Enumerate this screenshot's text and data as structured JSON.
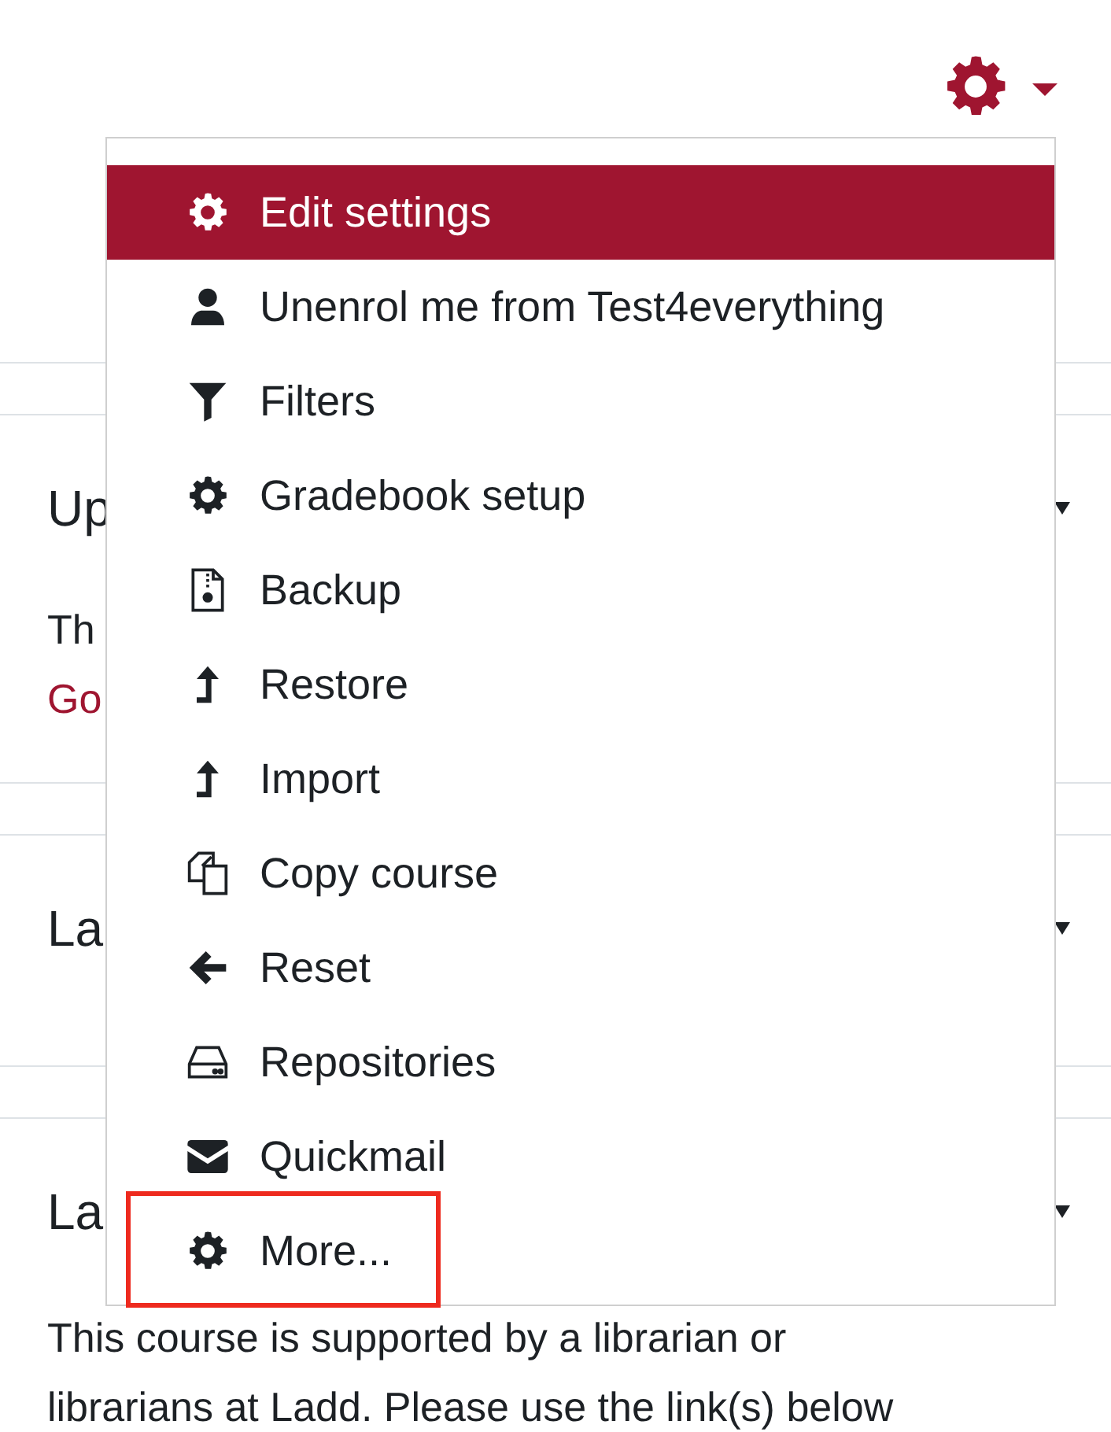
{
  "sections": [
    {
      "title": "Up",
      "lines": [
        {
          "text": "Th",
          "kind": "text"
        },
        {
          "text": "Go",
          "kind": "link"
        }
      ]
    },
    {
      "title": "La"
    },
    {
      "title": "La",
      "lines": [
        {
          "text": "This course is supported by a librarian or",
          "kind": "text"
        },
        {
          "text": "librarians at Ladd. Please use the link(s) below",
          "kind": "text"
        }
      ]
    }
  ],
  "menu": {
    "items": [
      {
        "label": "Edit settings",
        "selected": true,
        "annotated": false
      },
      {
        "label": "Unenrol me from Test4everything",
        "selected": false,
        "annotated": false
      },
      {
        "label": "Filters",
        "selected": false,
        "annotated": false
      },
      {
        "label": "Gradebook setup",
        "selected": false,
        "annotated": false
      },
      {
        "label": "Backup",
        "selected": false,
        "annotated": false
      },
      {
        "label": "Restore",
        "selected": false,
        "annotated": false
      },
      {
        "label": "Import",
        "selected": false,
        "annotated": false
      },
      {
        "label": "Copy course",
        "selected": false,
        "annotated": false
      },
      {
        "label": "Reset",
        "selected": false,
        "annotated": false
      },
      {
        "label": "Repositories",
        "selected": false,
        "annotated": false
      },
      {
        "label": "Quickmail",
        "selected": false,
        "annotated": false
      },
      {
        "label": "More...",
        "selected": false,
        "annotated": true
      }
    ]
  }
}
